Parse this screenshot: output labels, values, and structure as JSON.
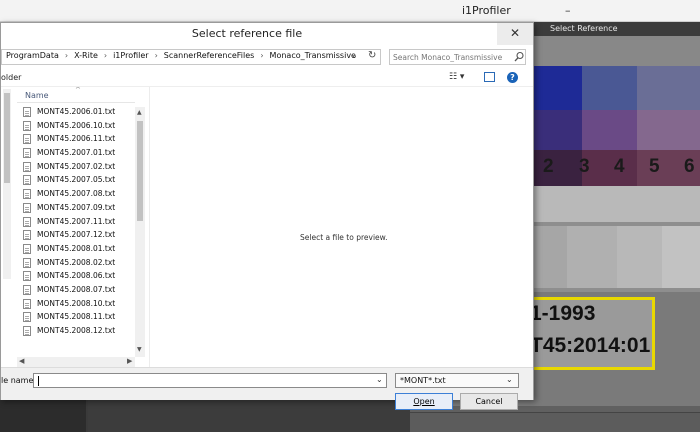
{
  "background_app": {
    "title": "i1Profiler",
    "minimize_glyph": "–",
    "select_reference_title": "Select Reference",
    "target_numbers": [
      "2",
      "3",
      "4",
      "5",
      "6"
    ],
    "label_line1": "1-1993",
    "label_line2": "T45:2014:01",
    "label_border_color": "#e8d800"
  },
  "dialog": {
    "title": "Select reference file",
    "close_glyph": "✕",
    "breadcrumb": [
      "ProgramData",
      "X-Rite",
      "i1Profiler",
      "ScannerReferenceFiles",
      "Monaco_Transmissive"
    ],
    "search_placeholder": "Search Monaco_Transmissive",
    "toolbar": {
      "new_folder": "older",
      "view_glyph": "☷ ▾",
      "help_glyph": "?"
    },
    "file_list": {
      "column_name": "Name",
      "files": [
        "MONT45.2006.01.txt",
        "MONT45.2006.10.txt",
        "MONT45.2006.11.txt",
        "MONT45.2007.01.txt",
        "MONT45.2007.02.txt",
        "MONT45.2007.05.txt",
        "MONT45.2007.08.txt",
        "MONT45.2007.09.txt",
        "MONT45.2007.11.txt",
        "MONT45.2007.12.txt",
        "MONT45.2008.01.txt",
        "MONT45.2008.02.txt",
        "MONT45.2008.06.txt",
        "MONT45.2008.07.txt",
        "MONT45.2008.10.txt",
        "MONT45.2008.11.txt",
        "MONT45.2008.12.txt"
      ]
    },
    "preview_text": "Select a file to preview.",
    "footer": {
      "file_name_label": "le name:",
      "file_name_value": "",
      "file_type": "*MONT*.txt",
      "open_label": "Open",
      "cancel_label": "Cancel"
    }
  }
}
